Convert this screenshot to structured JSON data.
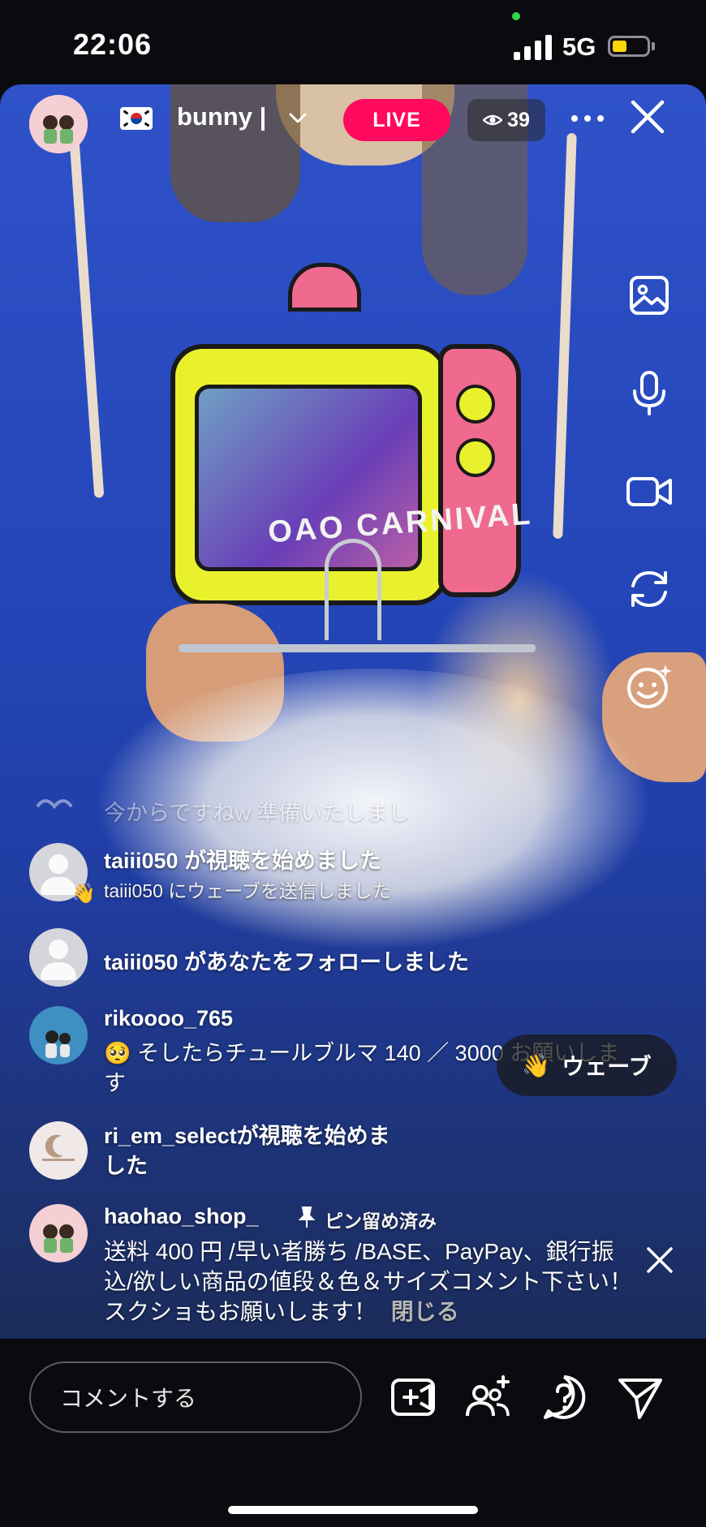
{
  "status_bar": {
    "time": "22:06",
    "network": "5G"
  },
  "live": {
    "host_name": "bunny |",
    "live_label": "LIVE",
    "viewer_count": "39",
    "flag": "south-korea-flag"
  },
  "video_overlay": {
    "shirt_text": "OAO CARNIVAL"
  },
  "side_tools": [
    "photo-icon",
    "microphone-icon",
    "video-camera-icon",
    "switch-camera-icon",
    "effects-icon"
  ],
  "comments": {
    "faded_text": "今からですねw 準備いたしまし",
    "items": [
      {
        "name": "taiii050 が視聴を始めました",
        "sub": "taiii050 にウェーブを送信しました"
      },
      {
        "name": "taiii050 があなたをフォローしました"
      },
      {
        "name": "rikoooo_765",
        "text": "🥺 そしたらチュールブルマ 140 ／ 3000 お願いします"
      },
      {
        "name": "ri_em_selectが視聴を始めました"
      },
      {
        "name": "haohao_shop_",
        "pinned": "ピン留め済み",
        "text": "送料 400 円 /早い者勝ち /BASE、PayPay、銀行振込/欲しい商品の値段＆色＆サイズコメント下さい！スクショもお願いします！",
        "close_label": "閉じる"
      }
    ]
  },
  "wave_button": {
    "emoji": "👋",
    "label": "ウェーブ"
  },
  "bottom_bar": {
    "comment_placeholder": "コメントする"
  }
}
